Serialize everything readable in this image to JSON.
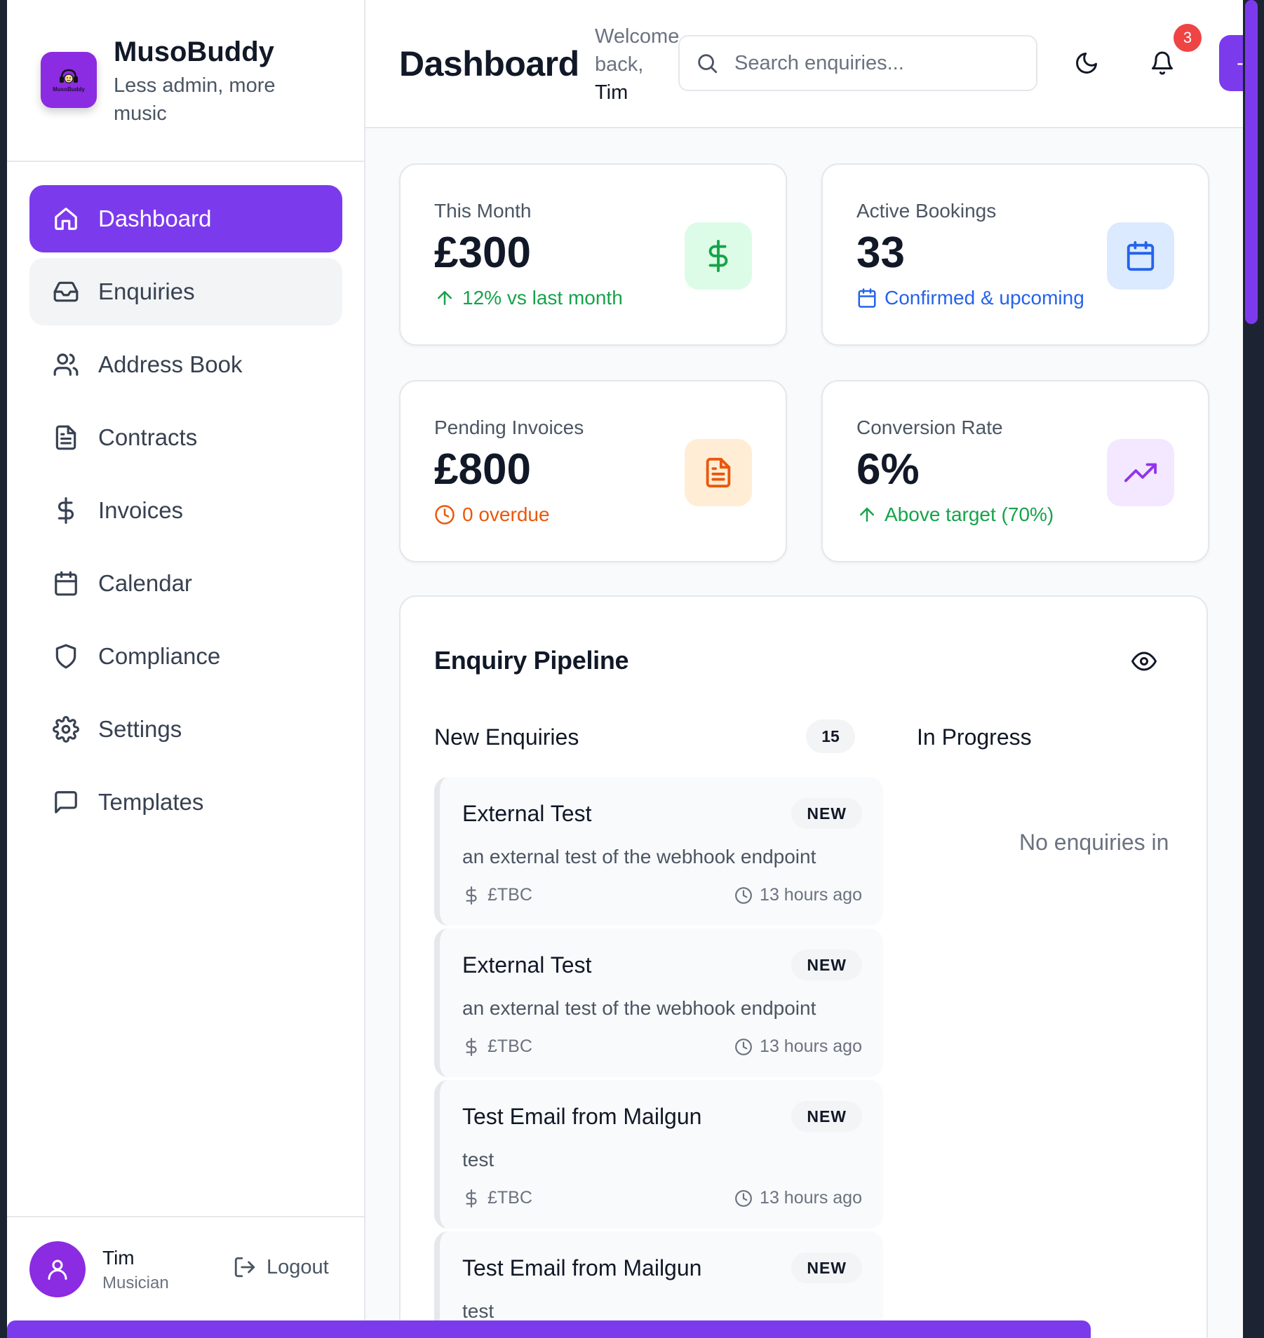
{
  "brand": {
    "name": "MusoBuddy",
    "tagline": "Less admin, more music",
    "logo_text": "MusoBuddy"
  },
  "nav": [
    {
      "label": "Dashboard",
      "icon": "home-icon",
      "active": true
    },
    {
      "label": "Enquiries",
      "icon": "inbox-icon"
    },
    {
      "label": "Address Book",
      "icon": "users-icon"
    },
    {
      "label": "Contracts",
      "icon": "file-text-icon"
    },
    {
      "label": "Invoices",
      "icon": "dollar-icon"
    },
    {
      "label": "Calendar",
      "icon": "calendar-icon"
    },
    {
      "label": "Compliance",
      "icon": "shield-icon"
    },
    {
      "label": "Settings",
      "icon": "gear-icon"
    },
    {
      "label": "Templates",
      "icon": "message-icon"
    }
  ],
  "user": {
    "name": "Tim",
    "role": "Musician",
    "logout_label": "Logout"
  },
  "header": {
    "title": "Dashboard",
    "welcome_prefix": "Welcome back,",
    "welcome_name": "Tim",
    "search_placeholder": "Search enquiries...",
    "notification_count": "3",
    "new_button_label": "-"
  },
  "stats": [
    {
      "label": "This Month",
      "value": "£300",
      "sub": "12% vs last month",
      "sub_color": "#16a34a",
      "icon": "dollar-icon",
      "icon_bg": "#dcfce7",
      "icon_color": "#16a34a"
    },
    {
      "label": "Active Bookings",
      "value": "33",
      "sub": "Confirmed & upcoming",
      "sub_color": "#2563eb",
      "icon": "calendar-icon",
      "icon_bg": "#dbeafe",
      "icon_color": "#2563eb"
    },
    {
      "label": "Pending Invoices",
      "value": "£800",
      "sub": "0 overdue",
      "sub_color": "#ea580c",
      "icon": "file-text-icon",
      "icon_bg": "#ffedd5",
      "icon_color": "#ea580c"
    },
    {
      "label": "Conversion Rate",
      "value": "6%",
      "sub": "Above target (70%)",
      "sub_color": "#16a34a",
      "icon": "trending-up-icon",
      "icon_bg": "#f3e8ff",
      "icon_color": "#9333ea"
    }
  ],
  "pipeline": {
    "title": "Enquiry Pipeline",
    "columns": [
      {
        "title": "New Enquiries",
        "count": "15"
      },
      {
        "title": "In Progress",
        "empty_text": "No enquiries in"
      }
    ],
    "cards": [
      {
        "title": "External Test",
        "badge": "NEW",
        "description": "an external test of the webhook endpoint",
        "price": "£TBC",
        "time": "13 hours ago"
      },
      {
        "title": "External Test",
        "badge": "NEW",
        "description": "an external test of the webhook endpoint",
        "price": "£TBC",
        "time": "13 hours ago"
      },
      {
        "title": "Test Email from Mailgun",
        "badge": "NEW",
        "description": "test",
        "price": "£TBC",
        "time": "13 hours ago"
      },
      {
        "title": "Test Email from Mailgun",
        "badge": "NEW",
        "description": "test",
        "price": "",
        "time": ""
      }
    ]
  },
  "colors": {
    "accent": "#7c3aed",
    "border": "#e5e7eb",
    "danger": "#ef4444"
  }
}
